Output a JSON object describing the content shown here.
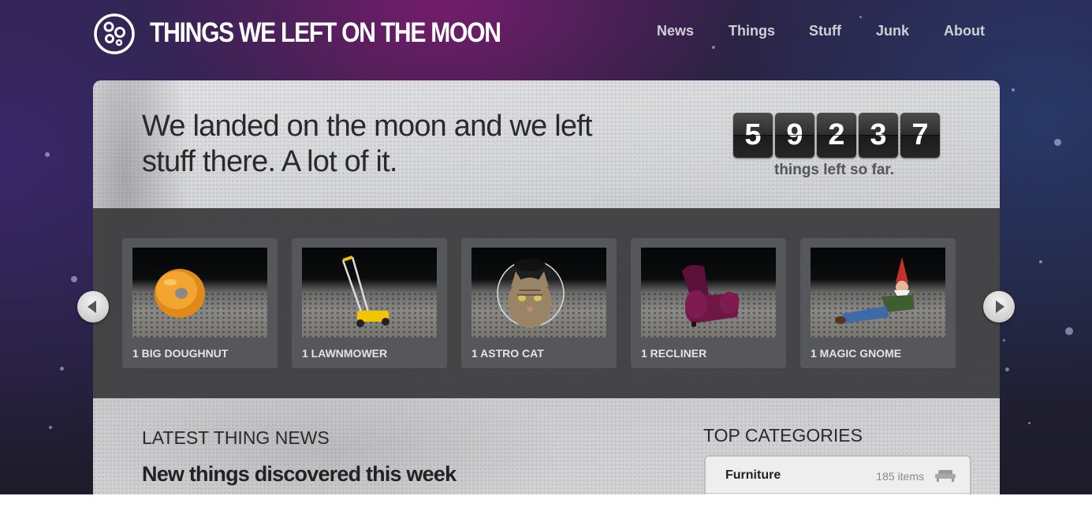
{
  "header": {
    "title": "THINGS WE LEFT ON THE MOON",
    "nav": [
      "News",
      "Things",
      "Stuff",
      "Junk",
      "About"
    ]
  },
  "hero": {
    "headline": "We landed on the moon and we left stuff there. A lot of it.",
    "counter_digits": [
      "5",
      "9",
      "2",
      "3",
      "7"
    ],
    "counter_label": "things left so far."
  },
  "carousel": {
    "items": [
      {
        "label": "1 BIG DOUGHNUT",
        "icon": "doughnut"
      },
      {
        "label": "1 LAWNMOWER",
        "icon": "lawnmower"
      },
      {
        "label": "1 ASTRO CAT",
        "icon": "astro-cat"
      },
      {
        "label": "1 RECLINER",
        "icon": "recliner"
      },
      {
        "label": "1 MAGIC GNOME",
        "icon": "gnome"
      }
    ],
    "prev_icon": "chevron-left-icon",
    "next_icon": "chevron-right-icon"
  },
  "news": {
    "section_title": "LATEST THING NEWS",
    "headline": "New things discovered this week"
  },
  "categories": {
    "section_title": "TOP CATEGORIES",
    "items": [
      {
        "name": "Furniture",
        "count": "185 items",
        "icon": "sofa-icon"
      }
    ]
  },
  "colors": {
    "accent_purple": "#7a1c6e",
    "band": "#3a3a3c",
    "card": "#56575a"
  }
}
